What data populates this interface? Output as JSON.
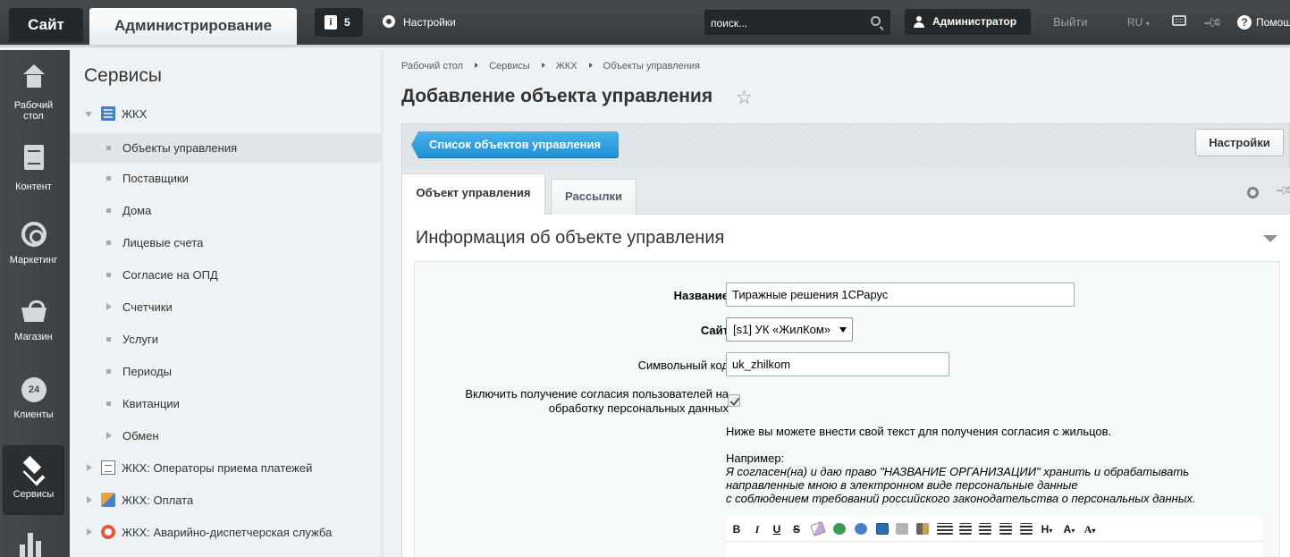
{
  "topbar": {
    "site_label": "Сайт",
    "admin_label": "Администрирование",
    "notifications_count": "5",
    "settings_label": "Настройки",
    "search_placeholder": "поиск...",
    "user_label": "Администратор",
    "logout_label": "Выйти",
    "lang_label": "RU",
    "help_label": "Помощь"
  },
  "iconmenu": {
    "items": [
      {
        "label1": "Рабочий",
        "label2": "стол",
        "icon": "home-icon"
      },
      {
        "label1": "Контент",
        "icon": "document-icon"
      },
      {
        "label1": "Маркетинг",
        "icon": "target-icon"
      },
      {
        "label1": "Магазин",
        "icon": "basket-icon"
      },
      {
        "label1": "Клиенты",
        "icon": "clock-24-icon",
        "icon_text": "24"
      },
      {
        "label1": "Сервисы",
        "icon": "layers-icon"
      }
    ]
  },
  "submenu": {
    "title": "Сервисы",
    "root": "ЖКХ",
    "items": [
      "Объекты управления",
      "Поставщики",
      "Дома",
      "Лицевые счета",
      "Согласие на ОПД",
      "Счетчики",
      "Услуги",
      "Периоды",
      "Квитанции",
      "Обмен"
    ],
    "groups": [
      "ЖКХ: Операторы приема платежей",
      "ЖКХ: Оплата",
      "ЖКХ: Аварийно-диспетчерская служба"
    ]
  },
  "breadcrumbs": [
    "Рабочий стол",
    "Сервисы",
    "ЖКХ",
    "Объекты управления"
  ],
  "page": {
    "title": "Добавление объекта управления",
    "list_button": "Список объектов управления",
    "settings_button": "Настройки",
    "tabs": [
      "Объект управления",
      "Рассылки"
    ],
    "section_title": "Информация об объекте управления"
  },
  "form": {
    "name_label": "Название",
    "name_value": "Тиражные решения 1СРарус",
    "site_label": "Сайт",
    "site_value": "[s1] УК «ЖилКом»",
    "code_label": "Символьный код",
    "code_value": "uk_zhilkom",
    "consent_label_1": "Включить получение согласия пользователей на",
    "consent_label_2": "обработку персональных данных",
    "consent_checked": true,
    "hint": "Ниже вы можете внести свой текст для получения согласия с жильцов.",
    "example_title": "Например:",
    "example_1": "Я согласен(на) и даю право \"НАЗВАНИЕ ОРГАНИЗАЦИИ\" хранить и обрабатывать",
    "example_2": "направленные мною в электронном виде персональные данные",
    "example_3": "с соблюдением требований российского законодательства о персональных данных."
  },
  "editor": {
    "bold": "B",
    "italic": "I",
    "underline": "U",
    "strike": "S",
    "heading": "H"
  }
}
